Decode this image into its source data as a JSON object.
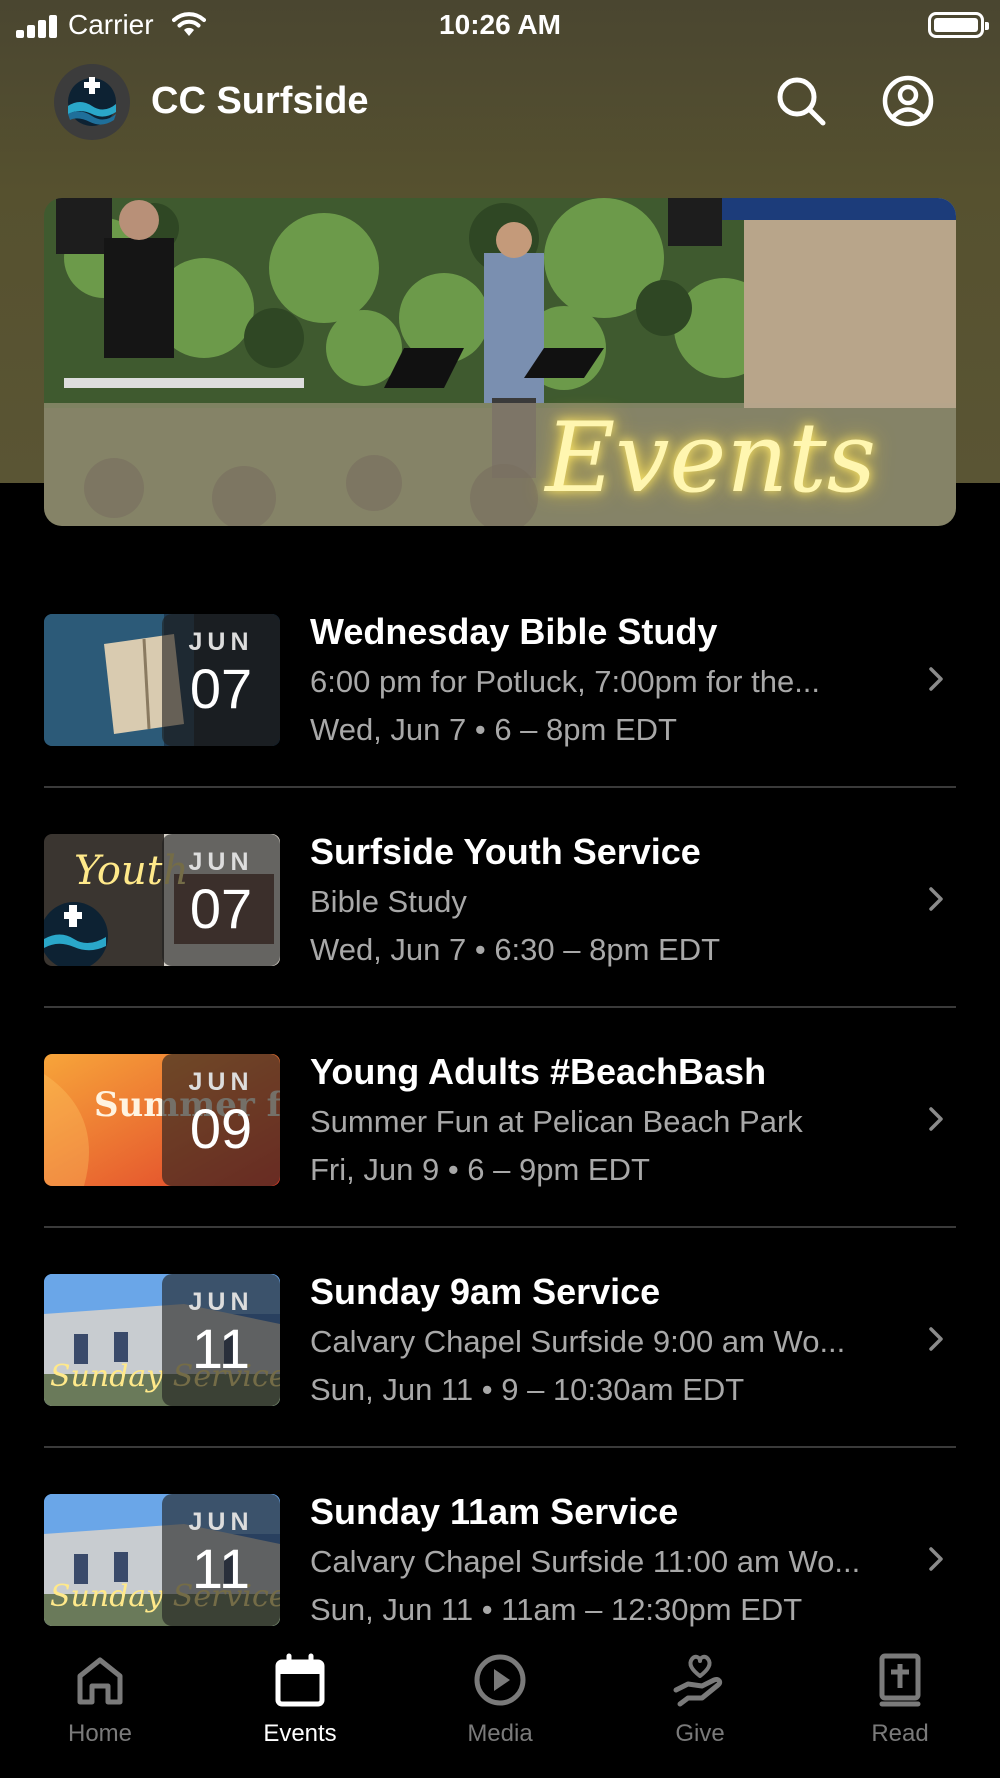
{
  "status_bar": {
    "carrier": "Carrier",
    "time": "10:26 AM"
  },
  "header": {
    "title": "CC Surfside",
    "icons": [
      "logo",
      "search-icon",
      "account-icon"
    ]
  },
  "banner": {
    "script_text": "Events"
  },
  "events": [
    {
      "month": "JUN",
      "day": "07",
      "title": "Wednesday Bible Study",
      "subtitle": "6:00 pm for Potluck, 7:00pm for the...",
      "time": "Wed, Jun 7 • 6 – 8pm EDT"
    },
    {
      "month": "JUN",
      "day": "07",
      "title": "Surfside Youth Service",
      "subtitle": "Bible Study",
      "time": "Wed, Jun 7 • 6:30 – 8pm EDT",
      "thumb_text": "Youth"
    },
    {
      "month": "JUN",
      "day": "09",
      "title": "Young Adults #BeachBash",
      "subtitle": "Summer Fun at Pelican Beach Park",
      "time": "Fri, Jun 9 • 6 – 9pm EDT",
      "thumb_text": "Summer fun"
    },
    {
      "month": "JUN",
      "day": "11",
      "title": "Sunday 9am Service",
      "subtitle": "Calvary Chapel Surfside 9:00 am Wo...",
      "time": "Sun, Jun 11 • 9 – 10:30am EDT",
      "thumb_text": "Sunday Service"
    },
    {
      "month": "JUN",
      "day": "11",
      "title": "Sunday 11am Service",
      "subtitle": "Calvary Chapel Surfside 11:00 am Wo...",
      "time": "Sun, Jun 11 • 11am – 12:30pm EDT",
      "thumb_text": "Sunday Service"
    }
  ],
  "tabs": [
    {
      "label": "Home",
      "icon": "home-icon",
      "active": false
    },
    {
      "label": "Events",
      "icon": "calendar-icon",
      "active": true
    },
    {
      "label": "Media",
      "icon": "play-icon",
      "active": false
    },
    {
      "label": "Give",
      "icon": "give-icon",
      "active": false
    },
    {
      "label": "Read",
      "icon": "bible-icon",
      "active": false
    }
  ],
  "colors": {
    "header_bg": "#56512f",
    "background": "#000000",
    "secondary_text": "#a8a8a8",
    "inactive_tab": "#7a7a7a"
  }
}
